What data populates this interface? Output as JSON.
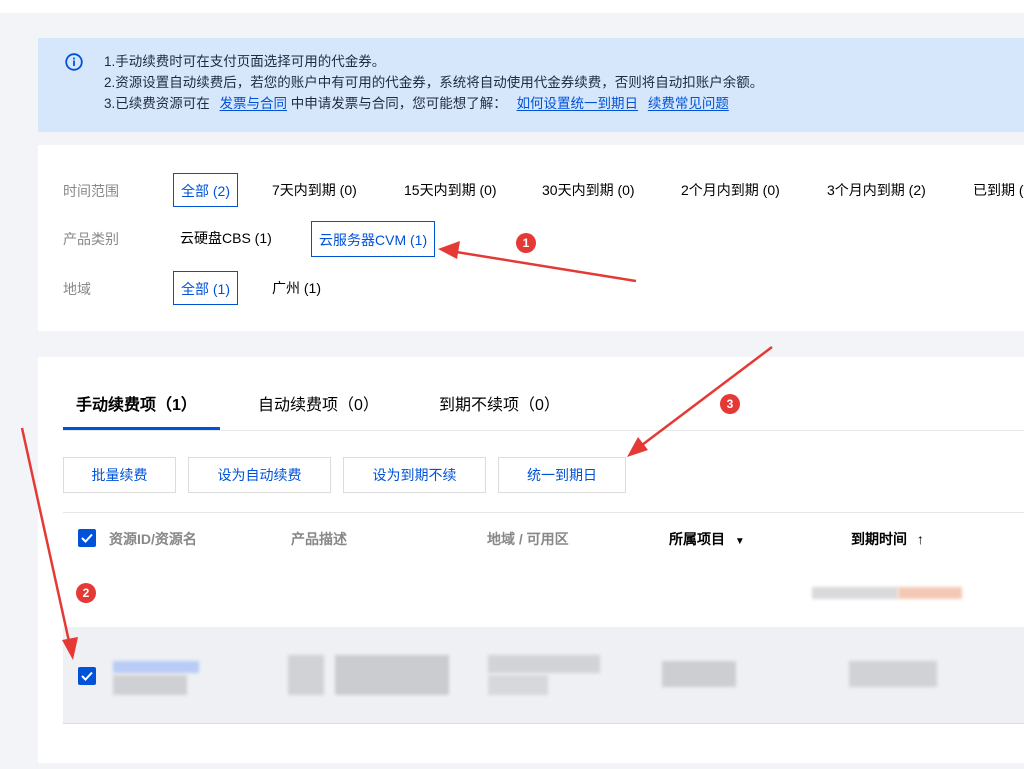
{
  "notice": {
    "line1": "1.手动续费时可在支付页面选择可用的代金券。",
    "line2": "2.资源设置自动续费后，若您的账户中有可用的代金券，系统将自动使用代金券续费，否则将自动扣账户余额。",
    "line3_prefix": "3.已续费资源可在",
    "line3_link1": "发票与合同",
    "line3_mid": "中申请发票与合同，您可能想了解：",
    "line3_link2": "如何设置统一到期日",
    "line3_link3": "续费常见问题"
  },
  "filters": {
    "time_label": "时间范围",
    "time_options": [
      "全部 (2)",
      "7天内到期 (0)",
      "15天内到期 (0)",
      "30天内到期 (0)",
      "2个月内到期 (0)",
      "3个月内到期 (2)",
      "已到期 ("
    ],
    "product_label": "产品类别",
    "product_options": [
      "云硬盘CBS (1)",
      "云服务器CVM (1)"
    ],
    "region_label": "地域",
    "region_options": [
      "全部 (1)",
      "广州 (1)"
    ]
  },
  "tabs": [
    "手动续费项（1）",
    "自动续费项（0）",
    "到期不续项（0）"
  ],
  "actions": [
    "批量续费",
    "设为自动续费",
    "设为到期不续",
    "统一到期日"
  ],
  "table": {
    "headers": [
      "资源ID/资源名",
      "产品描述",
      "地域 / 可用区",
      "所属项目",
      "到期时间"
    ],
    "filter_glyph": "▼",
    "sort_glyph": "↑"
  },
  "markers": [
    "1",
    "2",
    "3"
  ],
  "colors": {
    "accent": "#0052d9",
    "notice_bg": "#d6e7fc",
    "marker": "#e53935"
  }
}
